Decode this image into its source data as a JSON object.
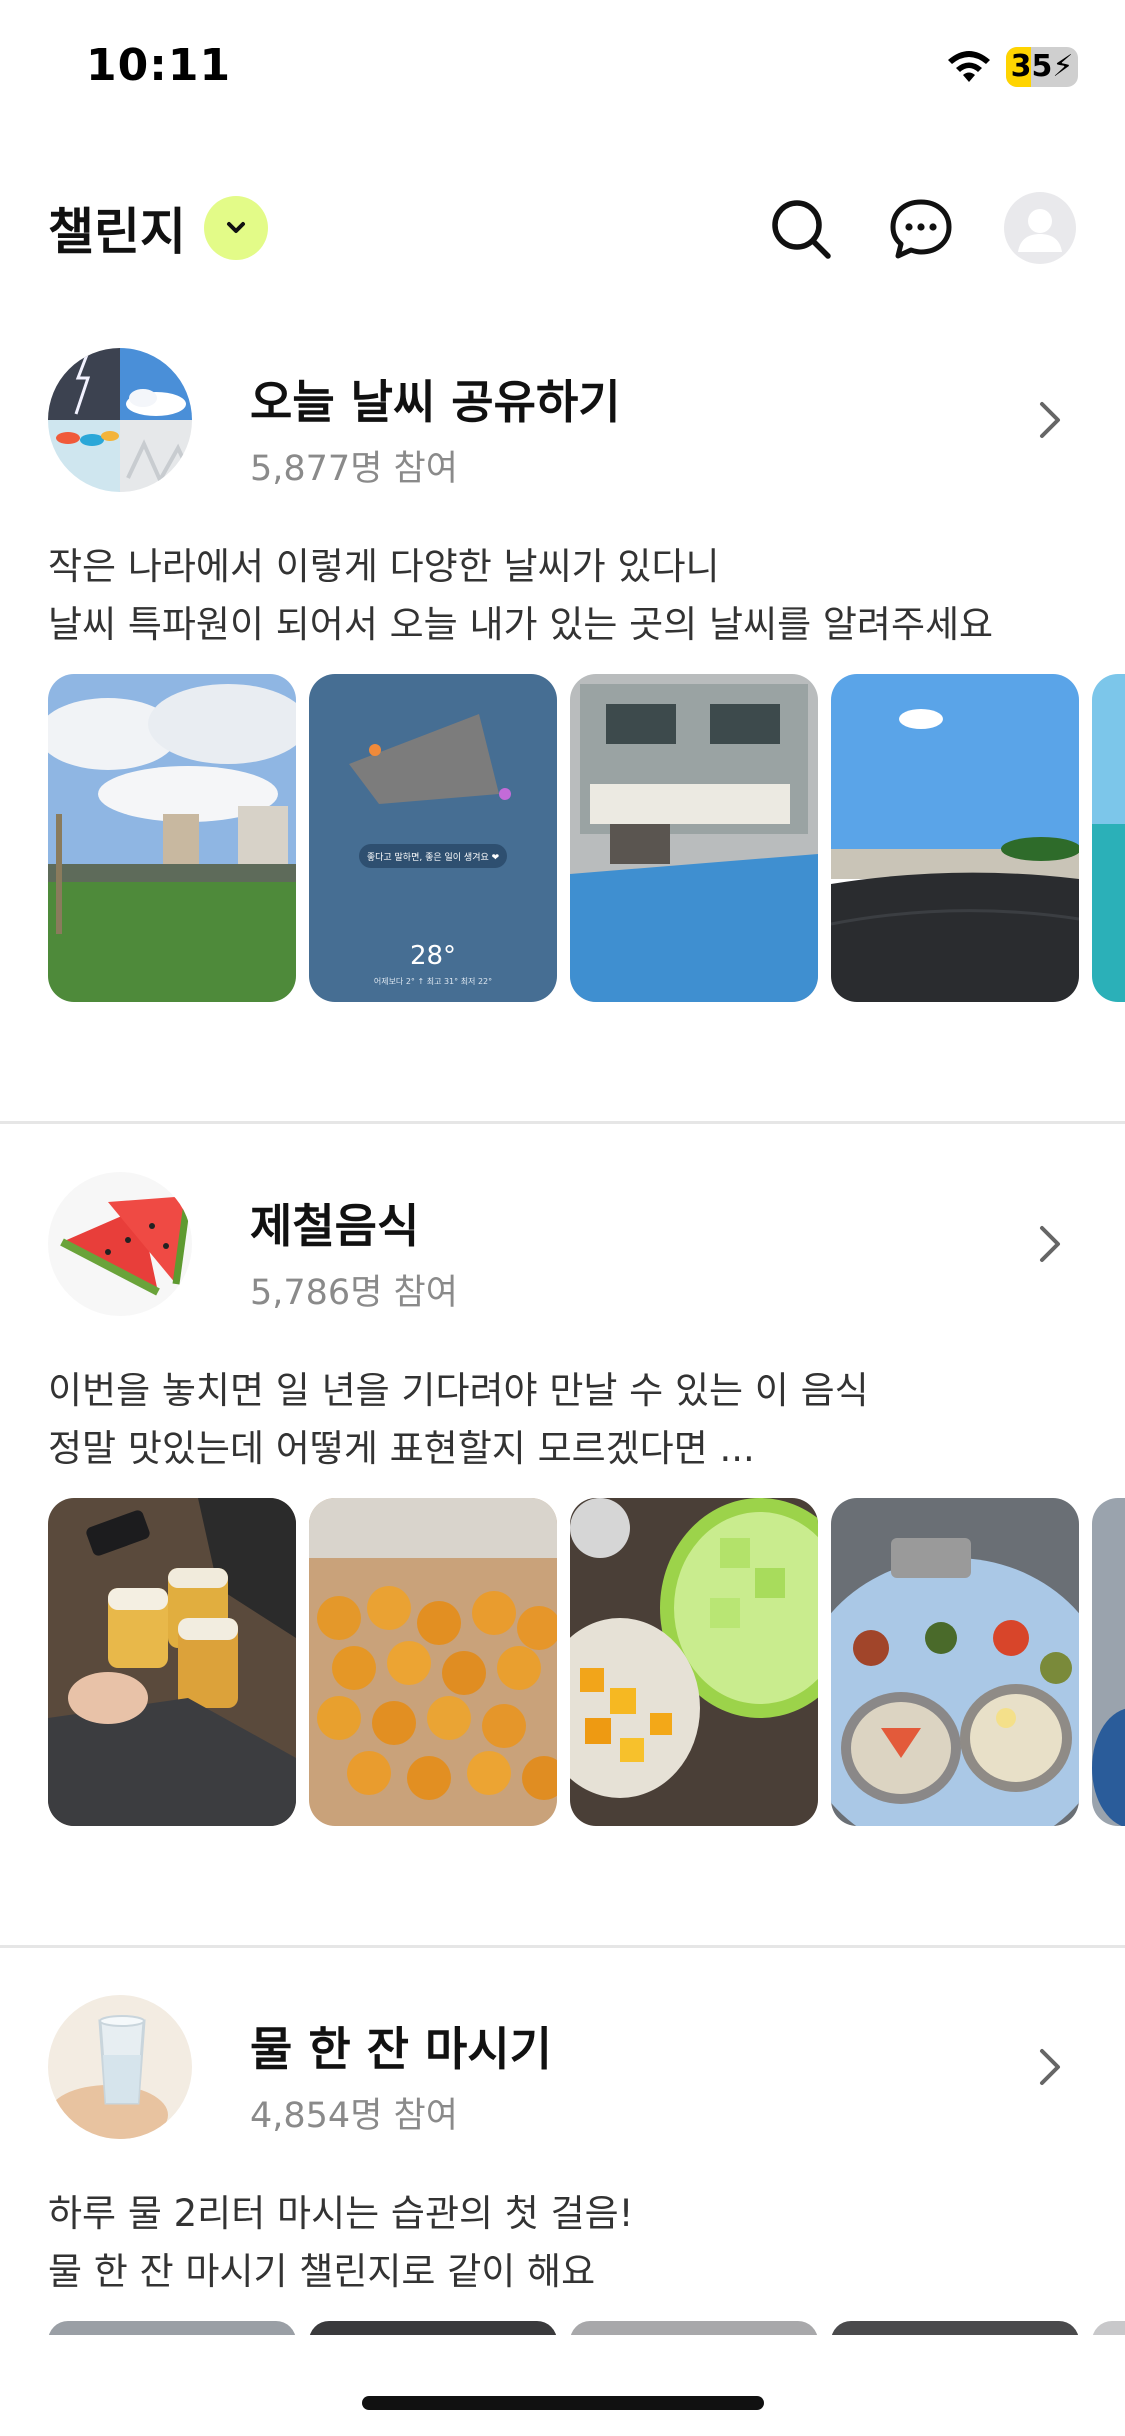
{
  "status": {
    "time": "10:11",
    "battery_level": "35",
    "battery_fraction": 0.35,
    "icons": [
      "wifi-icon",
      "battery-icon",
      "charging-bolt-icon"
    ]
  },
  "header": {
    "title": "챌린지",
    "icons": [
      "chevron-down-icon",
      "search-icon",
      "chat-bubble-icon",
      "profile-icon"
    ],
    "accent_color": "#e3fb88"
  },
  "challenges": [
    {
      "title": "오늘 날씨 공유하기",
      "participants": "5,877명 참여",
      "desc_line1": "작은 나라에서 이렇게 다양한 날씨가 있다니",
      "desc_line2": "날씨 특파원이 되어서 오늘 내가 있는 곳의 날씨를 알려주세요",
      "photo_card_text": "좋다고 말하면, 좋은 일이 생겨요 ❤",
      "photo_temp": "28°",
      "photo_temp_sub": "어제보다 2° ↑  최고 31°  최저 22°"
    },
    {
      "title": "제철음식",
      "participants": "5,786명 참여",
      "desc_line1": "이번을 놓치면 일 년을 기다려야 만날 수 있는 이 음식",
      "desc_line2": "정말 맛있는데 어떻게 표현할지 모르겠다면 ..."
    },
    {
      "title": "물 한 잔 마시기",
      "participants": "4,854명 참여",
      "desc_line1": "하루 물 2리터 마시는 습관의 첫 걸음!",
      "desc_line2": "물 한 잔 마시기 챌린지로 같이 해요"
    }
  ]
}
